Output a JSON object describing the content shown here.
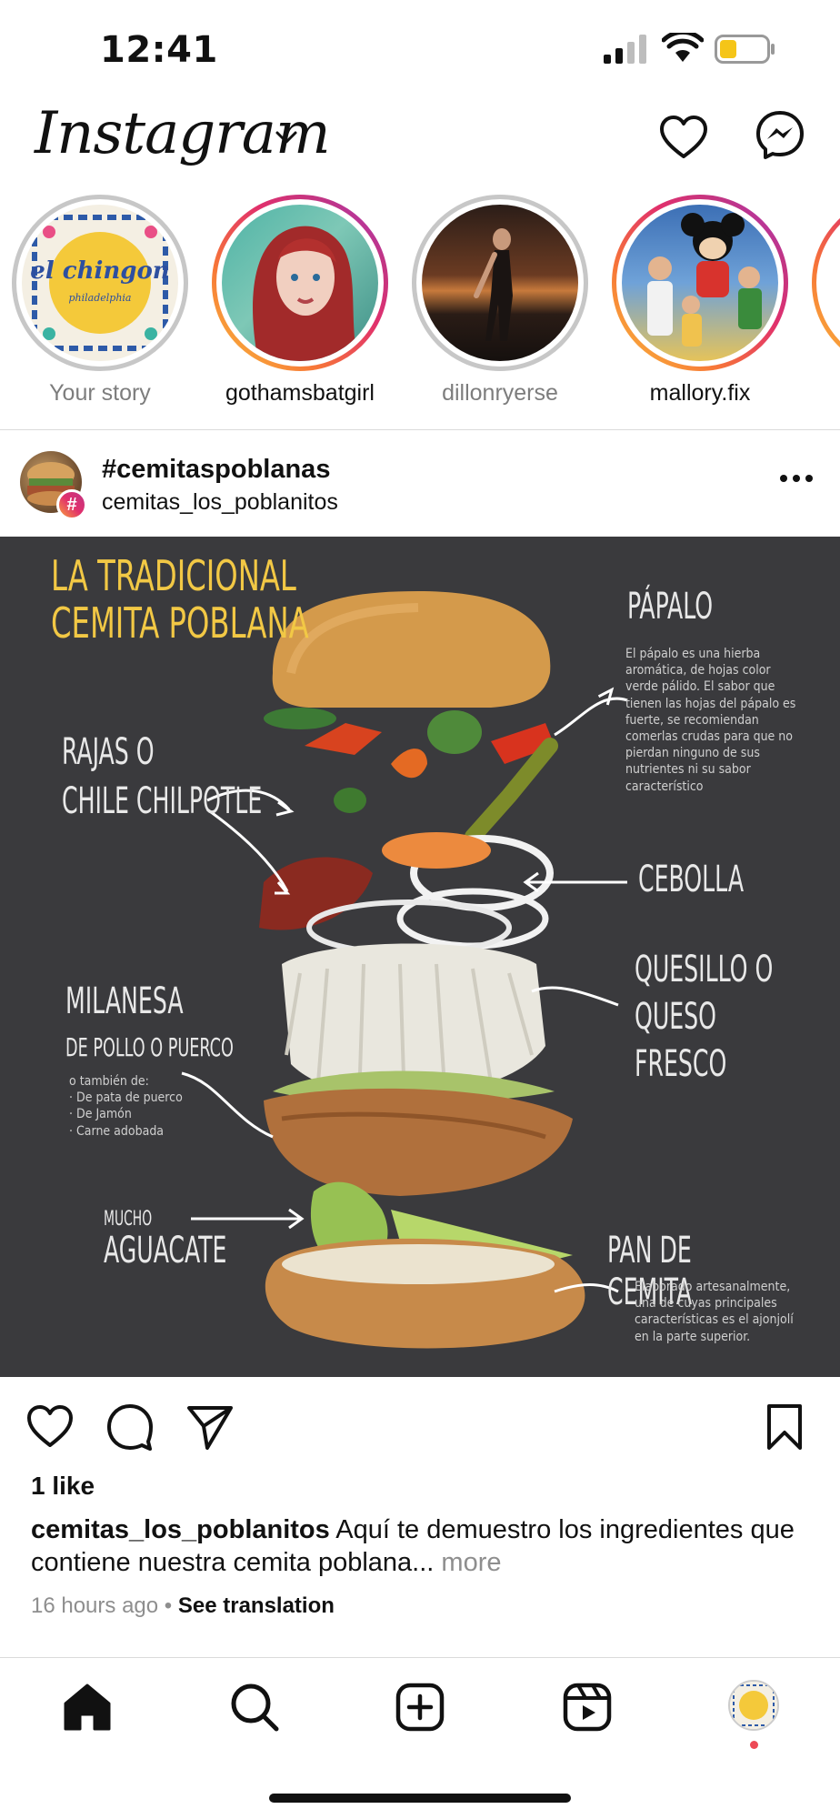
{
  "status_bar": {
    "time": "12:41"
  },
  "header": {
    "logo": "Instagram"
  },
  "stories": [
    {
      "label": "Your story",
      "state": "own",
      "avatar_text": "el chingon",
      "avatar_sub": "philadelphia"
    },
    {
      "label": "gothamsbatgirl",
      "state": "unseen"
    },
    {
      "label": "dillonryerse",
      "state": "seen"
    },
    {
      "label": "mallory.fix",
      "state": "unseen"
    }
  ],
  "post": {
    "hashtag": "#cemitaspoblanas",
    "account": "cemitas_los_poblanitos",
    "badge": "#",
    "image": {
      "title_line1": "LA TRADICIONAL",
      "title_line2": "CEMITA POBLANA",
      "papalo": "PÁPALO",
      "papalo_desc": "El pápalo es una hierba aromática, de hojas color verde pálido. El sabor que tienen las hojas del pápalo es fuerte, se recomiendan comerlas crudas para que no pierdan ninguno de sus nutrientes ni su sabor característico",
      "rajas_line1": "RAJAS O",
      "rajas_line2": "CHILE CHILPOTLE",
      "cebolla": "CEBOLLA",
      "quesillo_line1": "QUESILLO O",
      "quesillo_line2": "QUESO FRESCO",
      "milanesa": "MILANESA",
      "milanesa_sub": "DE POLLO O PUERCO",
      "milanesa_desc": "o también de:\n· De pata de puerco\n· De Jamón\n· Carne adobada",
      "aguacate_small": "MUCHO",
      "aguacate": "AGUACATE",
      "pan": "PAN DE CEMITA",
      "pan_desc": "Elaborado artesanalmente, una de cuyas principales características es el ajonjolí en la parte superior."
    },
    "likes": "1 like",
    "caption_user": "cemitas_los_poblanitos",
    "caption_text": " Aquí te demuestro los ingredientes que contiene nuestra cemita poblana... ",
    "caption_more": "more",
    "time_ago": "16 hours ago",
    "separator": " • ",
    "see_translation": "See translation"
  },
  "icons": [
    "signal-icon",
    "wifi-icon",
    "battery-icon",
    "chevron-down-icon",
    "heart-icon",
    "messenger-icon",
    "more-icon",
    "comment-icon",
    "share-icon",
    "bookmark-icon",
    "home-icon",
    "search-icon",
    "create-icon",
    "reels-icon"
  ],
  "colors": {
    "accent_yellow": "#f2c845",
    "notification": "#ed4956",
    "image_bg": "#3a3a3d"
  }
}
